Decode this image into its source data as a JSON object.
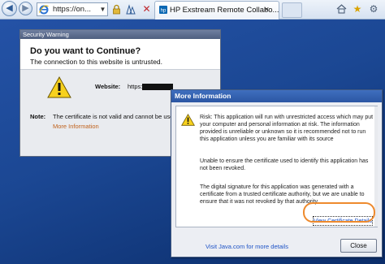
{
  "browser": {
    "address_text": "https://on...",
    "tab_title": "HP Exstream Remote Collabo...",
    "tab_close": "×"
  },
  "security_dialog": {
    "title": "Security Warning",
    "question": "Do you want to Continue?",
    "subtitle": "The connection to this website is untrusted.",
    "website_label": "Website:",
    "website_value": "https://",
    "note_label": "Note:",
    "note_text": "The certificate is not valid and cannot be used",
    "more_info_link": "More Information"
  },
  "more_info_dialog": {
    "title": "More Information",
    "risk_text": "Risk: This application will run with unrestricted access which may put your computer and personal information at risk. The information provided is unreliable or unknown so it is recommended not to run this application unless you are familiar with its source",
    "cert_text": "Unable to ensure the certificate used to identify this application has not been revoked.",
    "signature_text": "The digital signature for this application was generated with a certificate from a trusted certificate authority, but we are unable to ensure that it was not revoked by that authority.",
    "view_cert_link": "View Certificate Details",
    "visit_java_link": "Visit Java.com for more details",
    "close_label": "Close"
  },
  "colors": {
    "link_blue": "#1e53c6",
    "more_info_orange": "#c0621d",
    "highlight_ring": "#ee8a2d",
    "titlebar_blue": "#2b56a3"
  },
  "icons": [
    "back-icon",
    "forward-icon",
    "ie-icon",
    "lock-icon",
    "compatibility-icon",
    "stop-icon",
    "home-icon",
    "favorites-star-icon",
    "tools-gear-icon",
    "warning-icon"
  ]
}
